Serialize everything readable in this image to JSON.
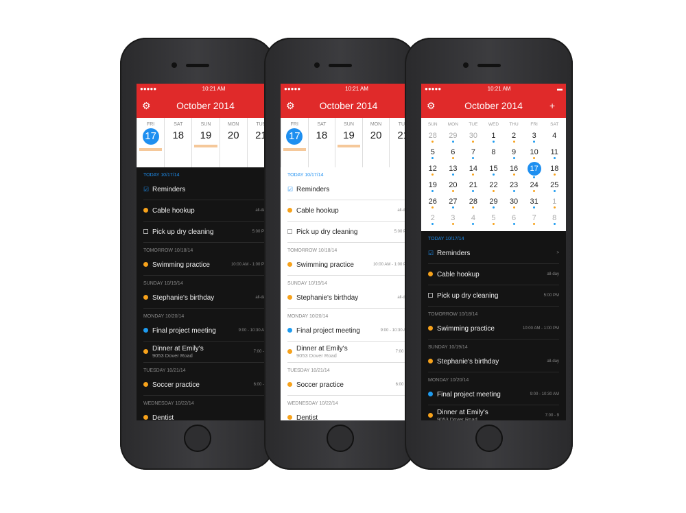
{
  "status": {
    "time": "10:21 AM",
    "signal": "●●●●●"
  },
  "header": {
    "title": "October 2014",
    "settings_icon": "gear-icon",
    "add_icon": "plus-icon",
    "add_label": "+",
    "gear_label": "⚙"
  },
  "colors": {
    "accent": "#e02a2a",
    "selected": "#1e8ff0",
    "orange": "#f7a21b",
    "blue": "#1e9bf0"
  },
  "week": [
    {
      "dn": "FRI",
      "num": "17",
      "sel": true,
      "bar": true
    },
    {
      "dn": "SAT",
      "num": "18"
    },
    {
      "dn": "SUN",
      "num": "19",
      "bar": true
    },
    {
      "dn": "MON",
      "num": "20"
    },
    {
      "dn": "TUE",
      "num": "21"
    }
  ],
  "weekdays": [
    "SUN",
    "MON",
    "TUE",
    "WED",
    "THU",
    "FRI",
    "SAT"
  ],
  "month": [
    [
      "28",
      "29",
      "30",
      "1",
      "2",
      "3",
      "4"
    ],
    [
      "5",
      "6",
      "7",
      "8",
      "9",
      "10",
      "11"
    ],
    [
      "12",
      "13",
      "14",
      "15",
      "16",
      "17",
      "18"
    ],
    [
      "19",
      "20",
      "21",
      "22",
      "23",
      "24",
      "25"
    ],
    [
      "26",
      "27",
      "28",
      "29",
      "30",
      "31",
      "1"
    ],
    [
      "2",
      "3",
      "4",
      "5",
      "6",
      "7",
      "8"
    ]
  ],
  "selected_day": "17",
  "agenda": [
    {
      "section": "TODAY 10/17/14",
      "today": true,
      "items": [
        {
          "mark": "check",
          "name": "Reminders",
          "time": "",
          "chevron": ">"
        },
        {
          "mark": "orange",
          "name": "Cable hookup",
          "time": "all-day"
        },
        {
          "mark": "box",
          "name": "Pick up dry cleaning",
          "time": "5:00 PM"
        }
      ]
    },
    {
      "section": "TOMORROW 10/18/14",
      "items": [
        {
          "mark": "orange",
          "name": "Swimming practice",
          "time": "10:00 AM - 1:00 PM"
        }
      ]
    },
    {
      "section": "SUNDAY 10/19/14",
      "items": [
        {
          "mark": "orange",
          "name": "Stephanie's birthday",
          "time": "all-day"
        }
      ]
    },
    {
      "section": "MONDAY 10/20/14",
      "items": [
        {
          "mark": "blue",
          "name": "Final project meeting",
          "time": "9:00 - 10:30 AM"
        },
        {
          "mark": "orange",
          "name": "Dinner at Emily's",
          "sub": "9053 Dover Road",
          "time": "7:00 - 9"
        }
      ]
    },
    {
      "section": "TUESDAY 10/21/14",
      "items": [
        {
          "mark": "orange",
          "name": "Soccer practice",
          "time": "6:00 - 8"
        }
      ]
    },
    {
      "section": "WEDNESDAY 10/22/14",
      "items": [
        {
          "mark": "orange",
          "name": "Dentist",
          "time": ""
        }
      ]
    }
  ]
}
